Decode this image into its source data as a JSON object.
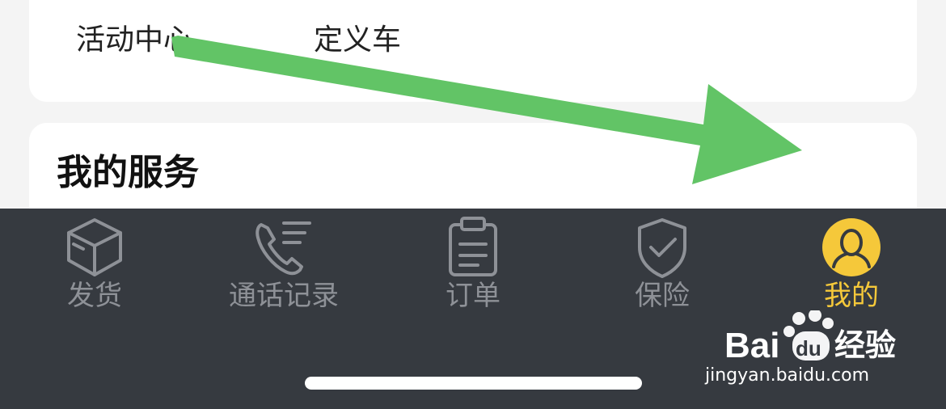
{
  "top_card": {
    "shortcuts": [
      "活动中心",
      "定义车"
    ]
  },
  "services": {
    "title": "我的服务"
  },
  "tabbar": {
    "active_color": "#f5c83a",
    "inactive_color": "#8e9197",
    "tabs": [
      {
        "label": "发货",
        "icon": "box-icon",
        "active": false
      },
      {
        "label": "通话记录",
        "icon": "phone-log-icon",
        "active": false
      },
      {
        "label": "订单",
        "icon": "clipboard-icon",
        "active": false
      },
      {
        "label": "保险",
        "icon": "shield-check-icon",
        "active": false
      },
      {
        "label": "我的",
        "icon": "user-avatar-icon",
        "active": true
      }
    ]
  },
  "annotation": {
    "arrow_color": "#62c466"
  },
  "watermark": {
    "brand": "Bai du 经验",
    "url": "jingyan.baidu.com"
  }
}
